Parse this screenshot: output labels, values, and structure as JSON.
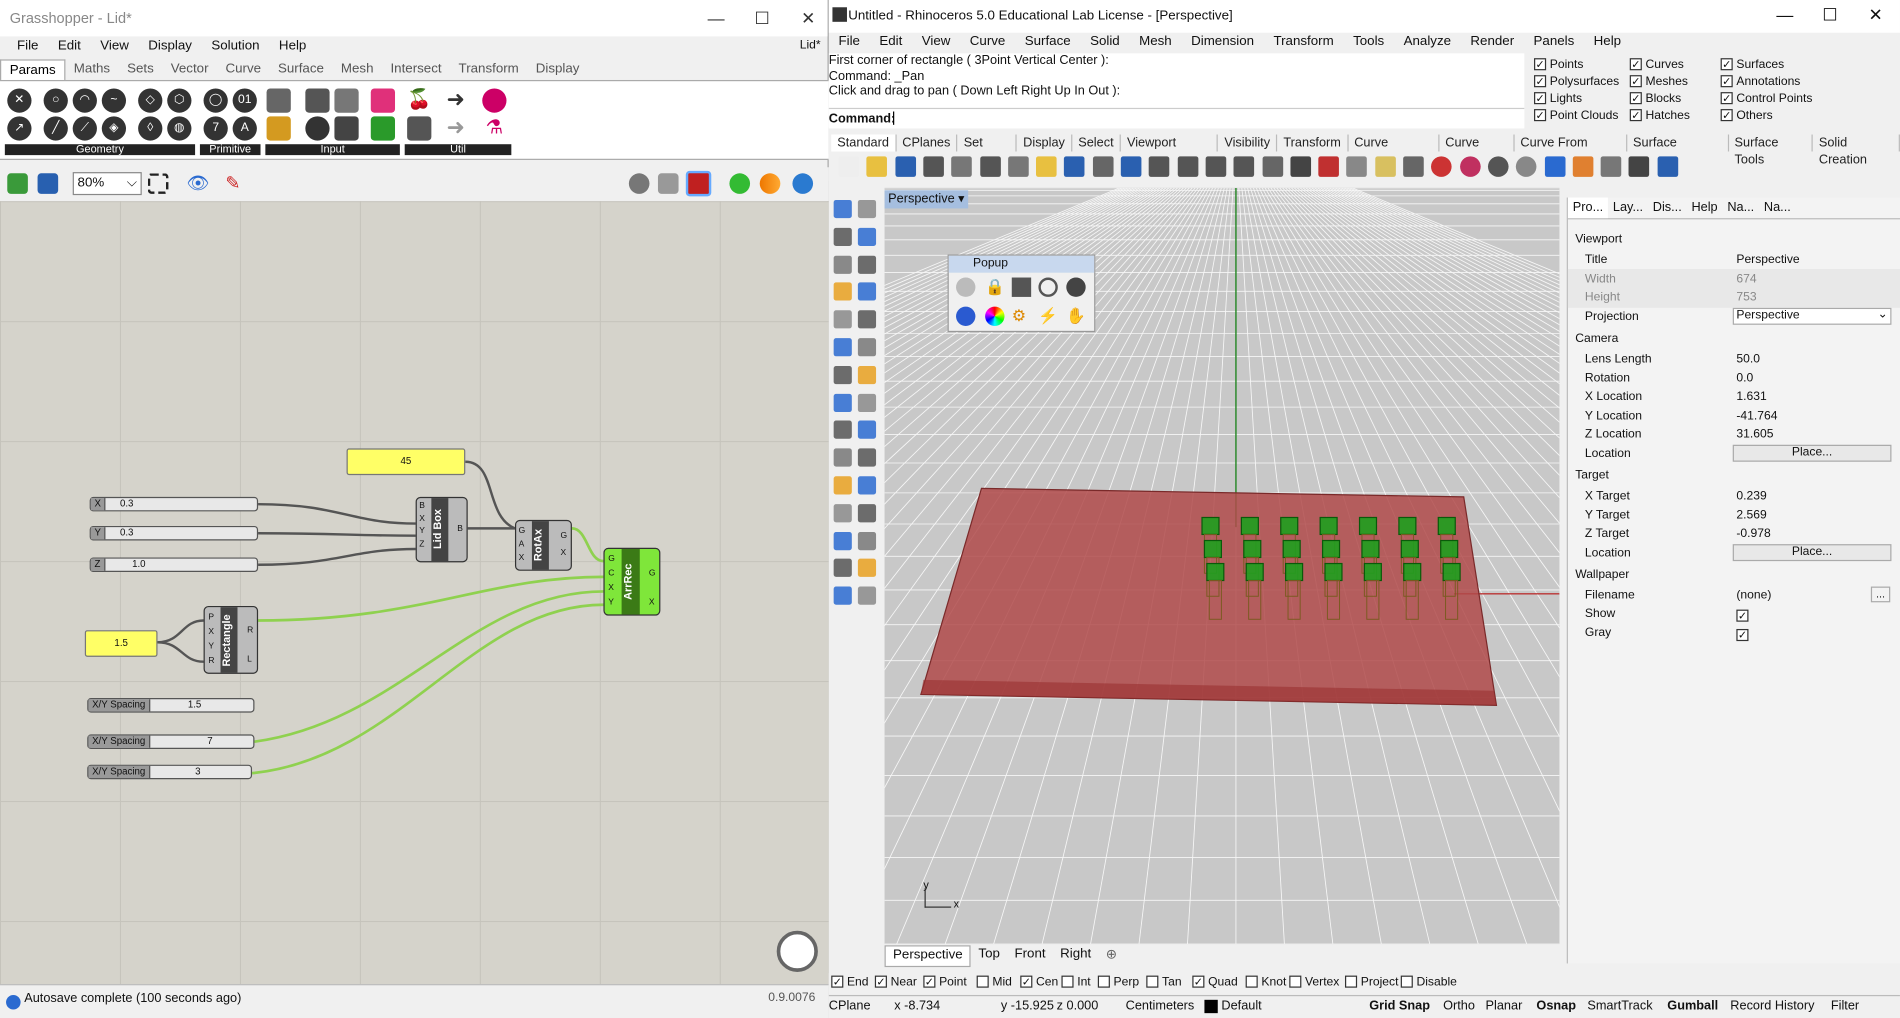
{
  "grasshopper": {
    "title": "Grasshopper - Lid*",
    "menu": [
      "File",
      "Edit",
      "View",
      "Display",
      "Solution",
      "Help"
    ],
    "doc_label": "Lid*",
    "tabs": [
      "Params",
      "Maths",
      "Sets",
      "Vector",
      "Curve",
      "Surface",
      "Mesh",
      "Intersect",
      "Transform",
      "Display"
    ],
    "categories": [
      "Geometry",
      "Primitive",
      "Input",
      "Util"
    ],
    "zoom": "80%",
    "status": "Autosave complete (100 seconds ago)",
    "version": "0.9.0076",
    "nodes": {
      "panel_45": "45",
      "panel_15": "1.5",
      "slider_x": {
        "label": "X",
        "value": "0.3"
      },
      "slider_y": {
        "label": "Y",
        "value": "0.3"
      },
      "slider_z": {
        "label": "Z",
        "value": "1.0"
      },
      "spacing_1": {
        "label": "X/Y Spacing",
        "value": "1.5"
      },
      "spacing_2": {
        "label": "X/Y Spacing",
        "value": "7"
      },
      "spacing_3": {
        "label": "X/Y Spacing",
        "value": "3"
      },
      "lidbox": {
        "name": "Lid Box",
        "inputs": [
          "B",
          "X",
          "Y",
          "Z"
        ],
        "output": "B"
      },
      "rotax": {
        "name": "RotAx",
        "inputs": [
          "G",
          "A",
          "X"
        ],
        "outputs": [
          "G",
          "X"
        ]
      },
      "rectangle": {
        "name": "Rectangle",
        "inputs": [
          "P",
          "X",
          "Y",
          "R"
        ],
        "outputs": [
          "R",
          "L"
        ]
      },
      "arrrec": {
        "name": "ArrRec",
        "inputs": [
          "G",
          "C",
          "X",
          "Y"
        ],
        "outputs": [
          "G",
          "X"
        ]
      }
    }
  },
  "rhino": {
    "title": "Untitled - Rhinoceros 5.0 Educational Lab License - [Perspective]",
    "menu": [
      "File",
      "Edit",
      "View",
      "Curve",
      "Surface",
      "Solid",
      "Mesh",
      "Dimension",
      "Transform",
      "Tools",
      "Analyze",
      "Render",
      "Panels",
      "Help"
    ],
    "history": [
      "First corner of rectangle ( 3Point  Vertical  Center ):",
      "Command: _Pan",
      "Click and drag to pan ( Down  Left  Right  Up  In  Out ):"
    ],
    "command_label": "Command:",
    "filters": [
      {
        "label": "Points",
        "checked": true
      },
      {
        "label": "Curves",
        "checked": true
      },
      {
        "label": "Surfaces",
        "checked": true
      },
      {
        "label": "Polysurfaces",
        "checked": true
      },
      {
        "label": "Meshes",
        "checked": true
      },
      {
        "label": "Annotations",
        "checked": true
      },
      {
        "label": "Lights",
        "checked": true
      },
      {
        "label": "Blocks",
        "checked": true
      },
      {
        "label": "Control Points",
        "checked": true
      },
      {
        "label": "Point Clouds",
        "checked": true
      },
      {
        "label": "Hatches",
        "checked": true
      },
      {
        "label": "Others",
        "checked": true
      }
    ],
    "toolbar_tabs": [
      "Standard",
      "CPlanes",
      "Set View",
      "Display",
      "Select",
      "Viewport Layout",
      "Visibility",
      "Transform",
      "Curve Drawing",
      "Curve Tools",
      "Curve From Object",
      "Surface Creation",
      "Surface Tools",
      "Solid Creation"
    ],
    "viewport_label": "Perspective",
    "popup_title": "Popup",
    "view_tabs": [
      "Perspective",
      "Top",
      "Front",
      "Right"
    ],
    "axis_y": "y",
    "axis_x": "x",
    "panel_tabs": [
      "Pro...",
      "Lay...",
      "Dis...",
      "Help",
      "Na...",
      "Na..."
    ],
    "props": {
      "sections": {
        "viewport": "Viewport",
        "camera": "Camera",
        "target": "Target",
        "wallpaper": "Wallpaper"
      },
      "title_l": "Title",
      "title_v": "Perspective",
      "width_l": "Width",
      "width_v": "674",
      "height_l": "Height",
      "height_v": "753",
      "proj_l": "Projection",
      "proj_v": "Perspective",
      "lens_l": "Lens Length",
      "lens_v": "50.0",
      "rot_l": "Rotation",
      "rot_v": "0.0",
      "xloc_l": "X Location",
      "xloc_v": "1.631",
      "yloc_l": "Y Location",
      "yloc_v": "-41.764",
      "zloc_l": "Z Location",
      "zloc_v": "31.605",
      "loc_l": "Location",
      "place": "Place...",
      "xt_l": "X Target",
      "xt_v": "0.239",
      "yt_l": "Y Target",
      "yt_v": "2.569",
      "zt_l": "Z Target",
      "zt_v": "-0.978",
      "tloc_l": "Location",
      "file_l": "Filename",
      "file_v": "(none)",
      "show_l": "Show",
      "gray_l": "Gray"
    },
    "osnap": [
      {
        "label": "End",
        "checked": true
      },
      {
        "label": "Near",
        "checked": true
      },
      {
        "label": "Point",
        "checked": true
      },
      {
        "label": "Mid",
        "checked": false
      },
      {
        "label": "Cen",
        "checked": true
      },
      {
        "label": "Int",
        "checked": false
      },
      {
        "label": "Perp",
        "checked": false
      },
      {
        "label": "Tan",
        "checked": false
      },
      {
        "label": "Quad",
        "checked": true
      },
      {
        "label": "Knot",
        "checked": false
      },
      {
        "label": "Vertex",
        "checked": false
      },
      {
        "label": "Project",
        "checked": false
      },
      {
        "label": "Disable",
        "checked": false
      }
    ],
    "status": {
      "cplane": "CPlane",
      "x": "x -8.734",
      "y": "y -15.925",
      "z": "z 0.000",
      "units": "Centimeters",
      "layer": "Default",
      "toggles": [
        "Grid Snap",
        "Ortho",
        "Planar",
        "Osnap",
        "SmartTrack",
        "Gumball",
        "Record History",
        "Filter"
      ]
    }
  },
  "colors": {
    "panel_yellow": "#ffff66",
    "arrrec_green": "#7fe63a",
    "wire_green": "#8fd14f",
    "ground_red": "#b04a4a",
    "box_green": "#1e9e1e"
  }
}
